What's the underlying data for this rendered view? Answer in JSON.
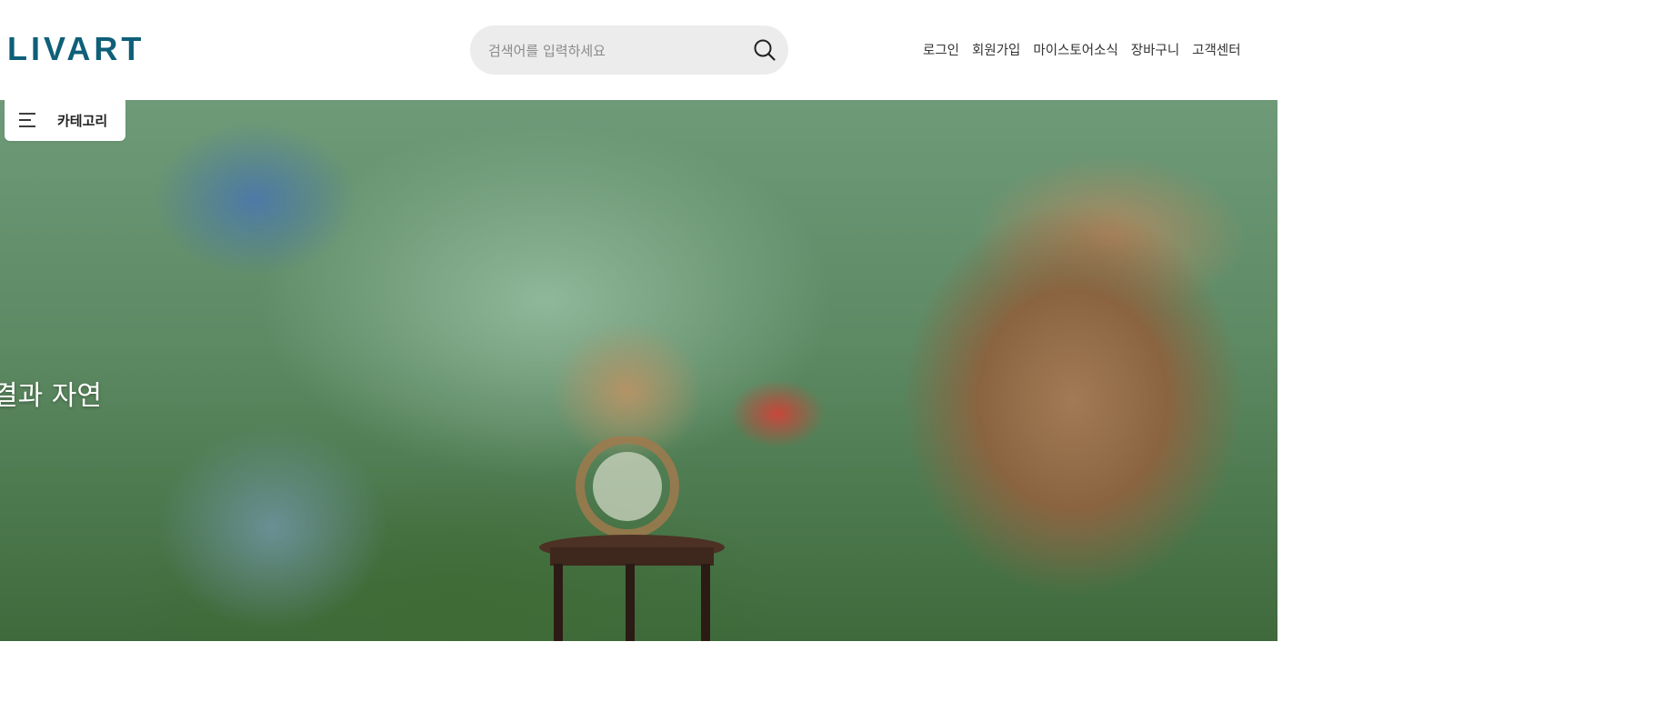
{
  "header": {
    "logo_text": "LIVART",
    "logo_color": "#0f5f79",
    "search": {
      "placeholder": "검색어를 입력하세요",
      "value": "",
      "icon": "search-icon"
    },
    "util_nav": [
      {
        "label": "로그인"
      },
      {
        "label": "회원가입"
      },
      {
        "label": "마이스토어소식"
      },
      {
        "label": "장바구니"
      },
      {
        "label": "고객센터"
      }
    ]
  },
  "category_button": {
    "label": "카테고리",
    "icon": "menu-icon"
  },
  "hero": {
    "caption": "결과 자연"
  }
}
